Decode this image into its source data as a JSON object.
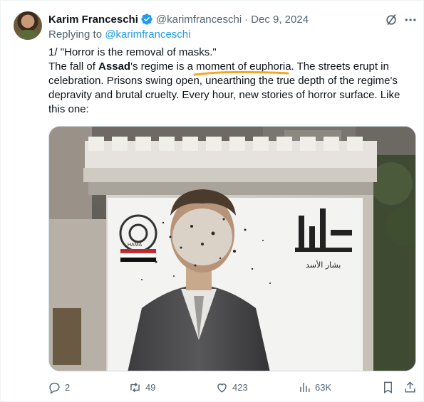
{
  "author": {
    "name": "Karim Franceschi",
    "handle": "@karimfranceschi",
    "separator": "·",
    "date": "Dec 9, 2024"
  },
  "replying": {
    "prefix": "Replying to",
    "target": "@karimfranceschi"
  },
  "tweet": {
    "line1": "1/ \"Horror is the removal of masks.\"",
    "p2_a": "The fall of ",
    "p2_bold": "Assad",
    "p2_b": "'s regime is a moment of euphoria. The streets erupt in celebration. Prisons swing open, unearthing the true depth of the regime's depravity and brutal cruelty. Every hour, new stories of horror surface. Like this one:"
  },
  "media": {
    "banner_left_logo_text": "HAMA",
    "banner_right_text": "بشار الأسد"
  },
  "actions": {
    "replies": "2",
    "reposts": "49",
    "likes": "423",
    "views": "63K"
  },
  "icons": {
    "verified": "verified-badge-icon",
    "grok": "grok-icon",
    "more": "more-icon",
    "reply": "reply-icon",
    "repost": "repost-icon",
    "like": "heart-icon",
    "views": "views-chart-icon",
    "bookmark": "bookmark-icon",
    "share": "share-icon"
  },
  "colors": {
    "accent": "#1d9bf0",
    "secondary_text": "#536471",
    "underline": "#f5a623"
  }
}
